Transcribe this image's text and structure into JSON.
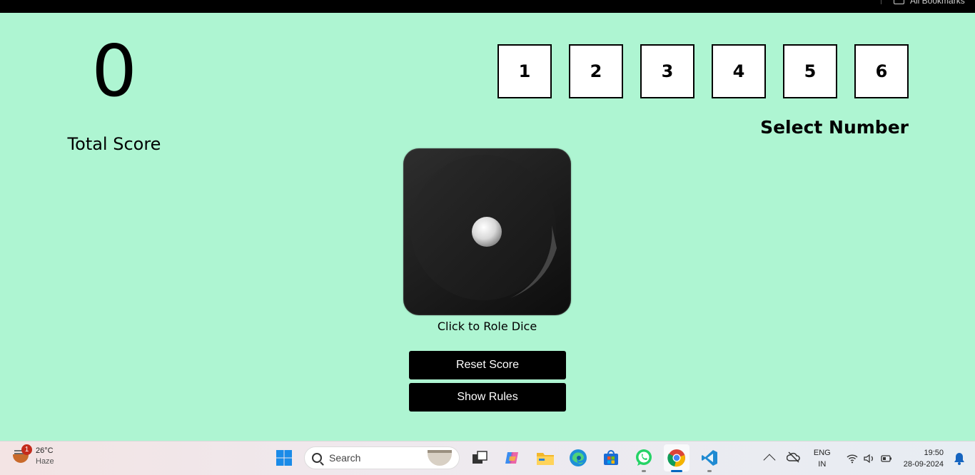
{
  "browser": {
    "bookmarks_label": "All Bookmarks"
  },
  "game": {
    "total_score_value": "0",
    "total_score_label": "Total Score",
    "numbers": [
      "1",
      "2",
      "3",
      "4",
      "5",
      "6"
    ],
    "select_number_label": "Select Number",
    "dice_face": 1,
    "dice_label": "Click to Role Dice",
    "reset_label": "Reset Score",
    "rules_label": "Show Rules",
    "colors": {
      "background": "#aef5d2",
      "button": "#000000",
      "dice": "#1f1f1f"
    }
  },
  "taskbar": {
    "weather_badge": "1",
    "temperature": "26°C",
    "condition": "Haze",
    "search_placeholder": "Search",
    "lang_top": "ENG",
    "lang_bottom": "IN",
    "time": "19:50",
    "date": "28-09-2024",
    "apps": [
      "start-icon",
      "task-view-icon",
      "copilot-icon",
      "file-explorer-icon",
      "edge-icon",
      "store-icon",
      "whatsapp-icon",
      "chrome-icon",
      "vscode-icon"
    ]
  }
}
